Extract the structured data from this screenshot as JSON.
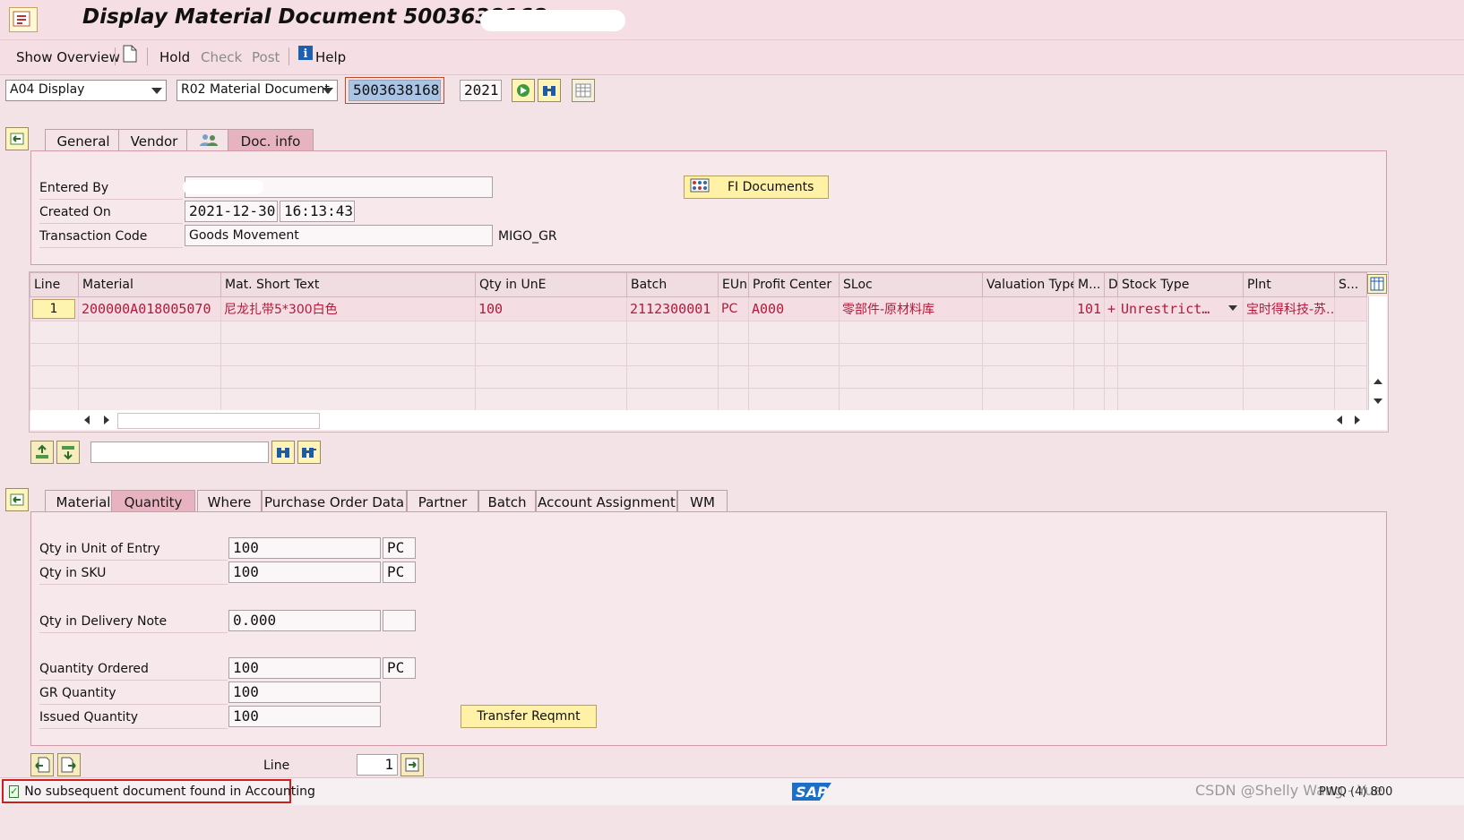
{
  "title": "Display Material Document 5003638168 -",
  "toolbar": {
    "show_overview": "Show Overview",
    "hold": "Hold",
    "check": "Check",
    "post": "Post",
    "help": "Help",
    "icons": [
      "new-document-icon",
      "info-icon"
    ]
  },
  "selection": {
    "action": "A04 Display",
    "reference": "R02 Material Document",
    "doc_number": "5003638168",
    "year": "2021"
  },
  "header_tabs": [
    "General",
    "Vendor",
    "Doc. info"
  ],
  "header_active_tab": "Doc. info",
  "doc_info": {
    "entered_by_label": "Entered By",
    "entered_by_value": "",
    "created_on_label": "Created On",
    "created_date": "2021-12-30",
    "created_time": "16:13:43",
    "tcode_label": "Transaction Code",
    "tcode_desc": "Goods Movement",
    "tcode": "MIGO_GR",
    "fi_button": "FI Documents"
  },
  "items": {
    "columns": [
      "Line",
      "Material",
      "Mat. Short Text",
      "Qty in UnE",
      "Batch",
      "EUn",
      "Profit Center",
      "SLoc",
      "Valuation Type",
      "M...",
      "D",
      "Stock Type",
      "Plnt",
      "S..."
    ],
    "rows": [
      {
        "line": "1",
        "material": "200000A018005070",
        "short_text": "尼龙扎带5*300白色",
        "qty": "100",
        "batch": "2112300001",
        "eun": "PC",
        "profit_center": "A000",
        "sloc": "零部件-原材料库",
        "valuation_type": "",
        "mvt": "101",
        "d": "+",
        "stock_type": "Unrestrict…",
        "plant": "宝时得科技-苏…",
        "s": ""
      }
    ]
  },
  "detail_tabs": [
    "Material",
    "Quantity",
    "Where",
    "Purchase Order Data",
    "Partner",
    "Batch",
    "Account Assignment",
    "WM"
  ],
  "detail_active_tab": "Quantity",
  "quantity": {
    "qty_entry_label": "Qty in Unit of Entry",
    "qty_entry": "100",
    "qty_entry_unit": "PC",
    "qty_sku_label": "Qty in SKU",
    "qty_sku": "100",
    "qty_sku_unit": "PC",
    "qty_delivery_label": "Qty in Delivery Note",
    "qty_delivery": "0.000",
    "qty_delivery_unit": "",
    "qty_ordered_label": "Quantity Ordered",
    "qty_ordered": "100",
    "qty_ordered_unit": "PC",
    "gr_qty_label": "GR Quantity",
    "gr_qty": "100",
    "issued_qty_label": "Issued Quantity",
    "issued_qty": "100",
    "transfer_button": "Transfer Reqmnt"
  },
  "line_nav": {
    "label": "Line",
    "value": "1"
  },
  "status": {
    "message": "No subsequent document found in Accounting",
    "sap_logo": "SAP",
    "watermark": "CSDN @Shelly Wang - Yue",
    "system": "PWQ (4) 800"
  },
  "colors": {
    "background": "#f3e3e7",
    "active_tab": "#e8b3c0",
    "data_text": "#b3193a",
    "status_border": "#d21d1d"
  }
}
